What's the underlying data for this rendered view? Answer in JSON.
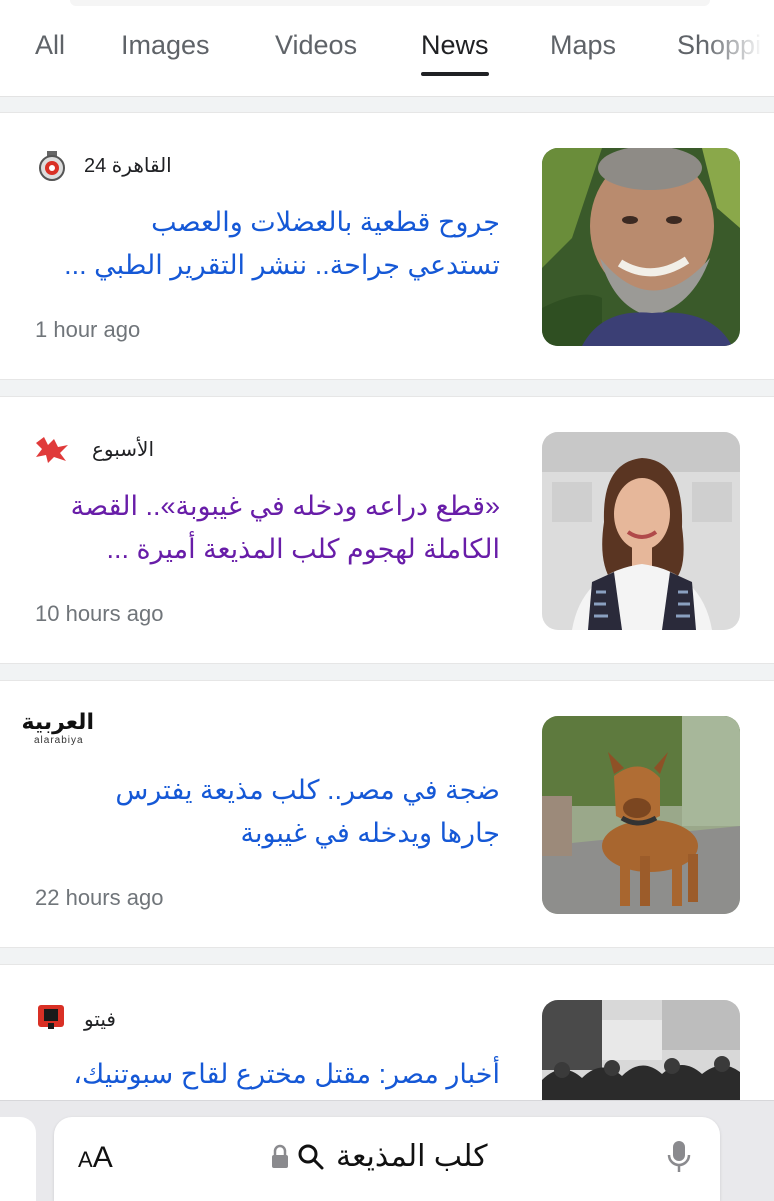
{
  "tabs": [
    {
      "label": "All",
      "active": false
    },
    {
      "label": "Images",
      "active": false
    },
    {
      "label": "Videos",
      "active": false
    },
    {
      "label": "News",
      "active": true
    },
    {
      "label": "Maps",
      "active": false
    },
    {
      "label": "Shoppi",
      "active": false
    }
  ],
  "articles": [
    {
      "source": "القاهرة 24",
      "headline_line1": "جروح قطعية بالعضلات والعصب",
      "headline_line2": "تستدعي جراحة.. ننشر التقرير الطبي ...",
      "time": "1 hour ago",
      "visited": false
    },
    {
      "source": "الأسبوع",
      "headline_line1": "«قطع دراعه ودخله في غيبوبة».. القصة",
      "headline_line2": "الكاملة لهجوم كلب المذيعة أميرة ...",
      "time": "10 hours ago",
      "visited": true
    },
    {
      "source": "",
      "logo_text": "العربية",
      "logo_subtext": "alarabiya",
      "headline_line1": "ضجة في مصر.. كلب مذيعة يفترس",
      "headline_line2": "جارها ويدخله في غيبوبة",
      "time": "22 hours ago",
      "visited": false
    },
    {
      "source": "فيتو",
      "headline_line1": "أخبار مصر: مقتل مخترع لقاح سبوتنيك،",
      "headline_line2": "",
      "time": "",
      "visited": false
    }
  ],
  "bottom_bar": {
    "aa_label_small": "A",
    "aa_label_large": "A",
    "address_text": "كلب المذيعة",
    "lock_icon": "lock-icon",
    "search_icon": "search-icon",
    "mic_icon": "microphone-icon"
  },
  "colors": {
    "link": "#1a0dab",
    "visited_link": "#681da8",
    "meta_text": "#70757a",
    "page_background": "#f1f3f4"
  }
}
